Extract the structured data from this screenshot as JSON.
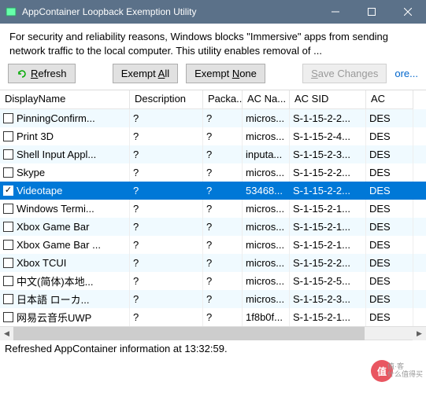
{
  "window": {
    "title": "AppContainer Loopback Exemption Utility"
  },
  "description": "For security and reliability reasons, Windows blocks \"Immersive\" apps from sending network traffic to the local computer. This utility enables removal of ...",
  "toolbar": {
    "refresh_pre": "R",
    "refresh_post": "efresh",
    "exempt_all_pre": "Exempt ",
    "exempt_all_ul": "A",
    "exempt_all_post": "ll",
    "exempt_none_pre": "Exempt ",
    "exempt_none_ul": "N",
    "exempt_none_post": "one",
    "save_ul": "S",
    "save_post": "ave Changes",
    "more": "ore..."
  },
  "columns": {
    "c0": "DisplayName",
    "c1": "Description",
    "c2": "Packa...",
    "c3": "AC Na...",
    "c4": "AC SID",
    "c5": "AC "
  },
  "rows": [
    {
      "checked": false,
      "sel": false,
      "c0": "PinningConfirm...",
      "c1": "?",
      "c2": "?",
      "c3": "micros...",
      "c4": "S-1-15-2-2...",
      "c5": "DES"
    },
    {
      "checked": false,
      "sel": false,
      "c0": "Print 3D",
      "c1": "?",
      "c2": "?",
      "c3": "micros...",
      "c4": "S-1-15-2-4...",
      "c5": "DES"
    },
    {
      "checked": false,
      "sel": false,
      "c0": "Shell Input Appl...",
      "c1": "?",
      "c2": "?",
      "c3": "inputa...",
      "c4": "S-1-15-2-3...",
      "c5": "DES"
    },
    {
      "checked": false,
      "sel": false,
      "c0": "Skype",
      "c1": "?",
      "c2": "?",
      "c3": "micros...",
      "c4": "S-1-15-2-2...",
      "c5": "DES"
    },
    {
      "checked": true,
      "sel": true,
      "c0": "Videotape",
      "c1": "?",
      "c2": "?",
      "c3": "53468...",
      "c4": "S-1-15-2-2...",
      "c5": "DES"
    },
    {
      "checked": false,
      "sel": false,
      "c0": "Windows Termi...",
      "c1": "?",
      "c2": "?",
      "c3": "micros...",
      "c4": "S-1-15-2-1...",
      "c5": "DES"
    },
    {
      "checked": false,
      "sel": false,
      "c0": "Xbox Game Bar",
      "c1": "?",
      "c2": "?",
      "c3": "micros...",
      "c4": "S-1-15-2-1...",
      "c5": "DES"
    },
    {
      "checked": false,
      "sel": false,
      "c0": "Xbox Game Bar ...",
      "c1": "?",
      "c2": "?",
      "c3": "micros...",
      "c4": "S-1-15-2-1...",
      "c5": "DES"
    },
    {
      "checked": false,
      "sel": false,
      "c0": "Xbox TCUI",
      "c1": "?",
      "c2": "?",
      "c3": "micros...",
      "c4": "S-1-15-2-2...",
      "c5": "DES"
    },
    {
      "checked": false,
      "sel": false,
      "c0": "中文(简体)本地...",
      "c1": "?",
      "c2": "?",
      "c3": "micros...",
      "c4": "S-1-15-2-5...",
      "c5": "DES"
    },
    {
      "checked": false,
      "sel": false,
      "c0": "日本語 ローカ...",
      "c1": "?",
      "c2": "?",
      "c3": "micros...",
      "c4": "S-1-15-2-3...",
      "c5": "DES"
    },
    {
      "checked": false,
      "sel": false,
      "c0": "网易云音乐UWP",
      "c1": "?",
      "c2": "?",
      "c3": "1f8b0f...",
      "c4": "S-1-15-2-1...",
      "c5": "DES"
    }
  ],
  "status": "Refreshed AppContainer information at 13:32:59.",
  "watermark": {
    "badge": "值",
    "line1": "值·客",
    "line2": "什么值得买"
  }
}
